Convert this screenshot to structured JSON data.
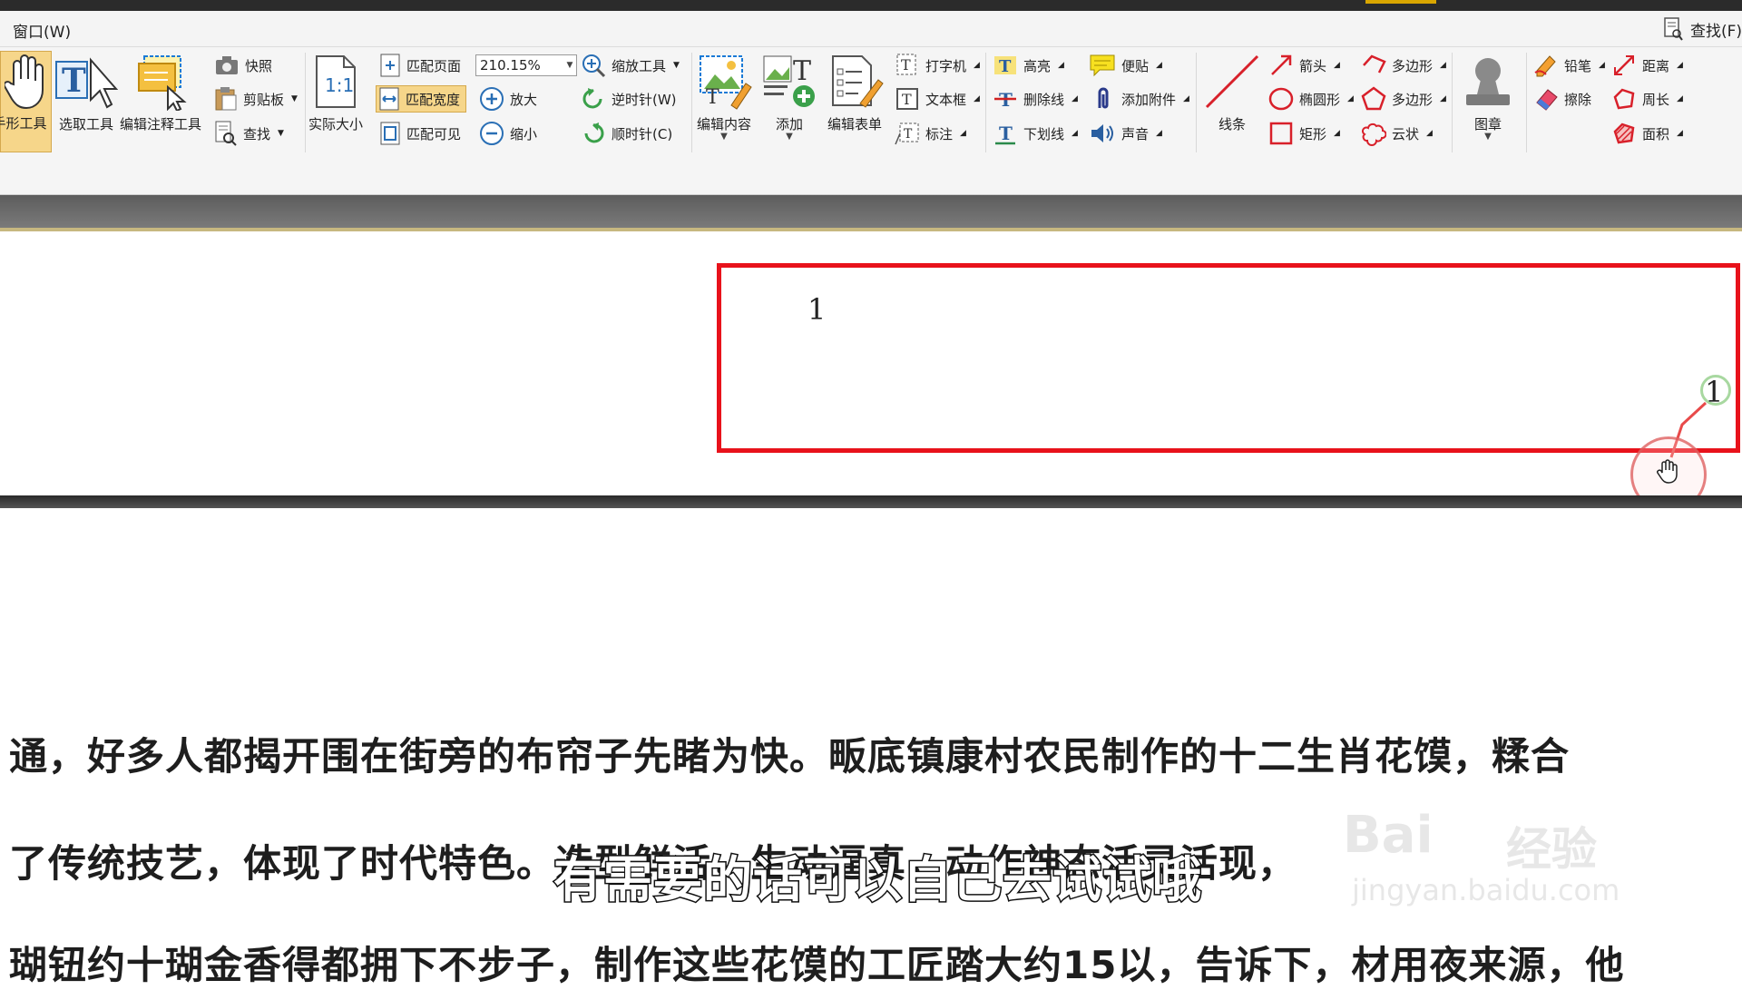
{
  "app": {
    "menu_window": "窗口(W)",
    "find_label": "查找(F)"
  },
  "toolbar": {
    "hand_tool": "手形工具",
    "select_tool": "选取工具",
    "edit_annot_tool": "编辑注释工具",
    "snapshot": "快照",
    "clipboard": "剪贴板",
    "find": "查找",
    "actual_size_icon_text": "1:1",
    "actual_size": "实际大小",
    "fit_page": "匹配页面",
    "fit_width": "匹配宽度",
    "fit_visible": "匹配可见",
    "zoom_value": "210.15%",
    "zoom_in": "放大",
    "zoom_out": "缩小",
    "zoom_tool": "缩放工具",
    "rotate_ccw": "逆时针(W)",
    "rotate_cw": "顺时针(C)",
    "edit_content": "编辑内容",
    "add": "添加",
    "edit_form": "编辑表单",
    "typewriter": "打字机",
    "textbox": "文本框",
    "callout": "标注",
    "highlight": "高亮",
    "strikeout": "删除线",
    "underline": "下划线",
    "note": "便贴",
    "attach": "添加附件",
    "sound": "声音",
    "line": "线条",
    "arrow": "箭头",
    "ellipse": "椭圆形",
    "rectangle": "矩形",
    "polyline": "多边形",
    "polygon": "多边形",
    "cloud": "云状",
    "stamp": "图章",
    "pencil": "铅笔",
    "eraser": "擦除",
    "distance": "距离",
    "perimeter": "周长",
    "area": "面积"
  },
  "document": {
    "page_number": "1",
    "measure_label": "1",
    "body_lines": [
      "通，好多人都揭开围在街旁的布帘子先睹为快。畈底镇康村农民制作的十二生肖花馍，糅合",
      "了传统技艺，体现了时代特色。造型鲜活，生动逼真，动作神态活灵活现，",
      "瑚钮约十瑚金香得都拥下不步子，制作这些花馍的工匠踏大约15以，告诉下，材用夜来源，他"
    ]
  },
  "overlay": {
    "subtitle": "有需要的话可以自己去试试哦",
    "watermark_brand": "Bai",
    "watermark_cn": "经验",
    "watermark_url": "jingyan.baidu.com"
  },
  "colors": {
    "annotation_red": "#e8121b",
    "active_tool_bg": "#f6d68a",
    "measure_green": "#a8d8a0"
  }
}
